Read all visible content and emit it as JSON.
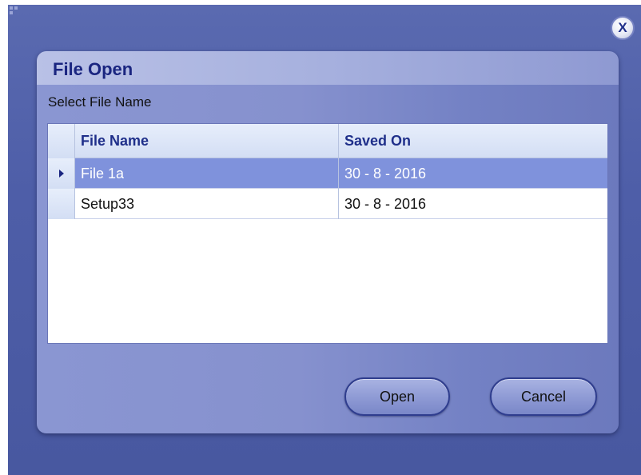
{
  "window": {
    "close_label": "X"
  },
  "dialog": {
    "title": "File Open",
    "select_label": "Select File Name",
    "table": {
      "columns": [
        "File Name",
        "Saved On"
      ],
      "rows": [
        {
          "name": "File 1a",
          "saved_on": "30 - 8 - 2016",
          "selected": true
        },
        {
          "name": "Setup33",
          "saved_on": "30 - 8 - 2016",
          "selected": false
        }
      ]
    },
    "buttons": {
      "open_label": "Open",
      "cancel_label": "Cancel"
    }
  },
  "colors": {
    "window_bg": "#4e5ea8",
    "dialog_bg": "#8691ce",
    "title_text": "#1a2580",
    "selected_row": "#7f92dc"
  },
  "icons": {
    "window_grip": "grip-icon",
    "close": "close-icon",
    "row_indicator": "triangle-right-icon"
  }
}
